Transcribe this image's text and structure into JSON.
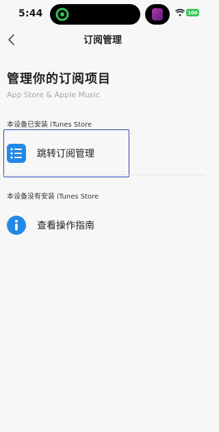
{
  "status_bar": {
    "time": "5:44",
    "battery": "100"
  },
  "nav": {
    "title": "订阅管理",
    "back_icon": "chevron-left-icon"
  },
  "header": {
    "title": "管理你的订阅项目",
    "subtitle": "App Store & Apple Music"
  },
  "sections": [
    {
      "label": "本设备已安装 iTunes Store",
      "action_label": "跳转订阅管理",
      "icon": "list-icon"
    },
    {
      "label": "本设备没有安装 iTunes Store",
      "action_label": "查看操作指南",
      "icon": "info-icon"
    }
  ],
  "colors": {
    "accent": "#2389e6",
    "highlight": "#2c3fbd",
    "battery": "#35c759"
  }
}
